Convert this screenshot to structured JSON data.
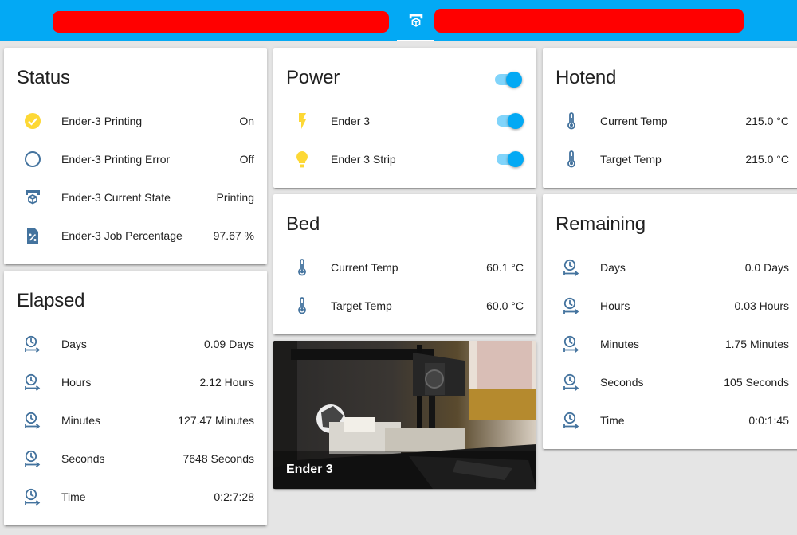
{
  "colors": {
    "primary": "#03a9f4",
    "icon_state_on": "#fdd835",
    "icon_default": "#44739e"
  },
  "status_card": {
    "title": "Status",
    "rows": [
      {
        "name": "Ender-3 Printing",
        "value": "On",
        "icon": "check-circle-icon"
      },
      {
        "name": "Ender-3 Printing Error",
        "value": "Off",
        "icon": "circle-outline-icon"
      },
      {
        "name": "Ender-3 Current State",
        "value": "Printing",
        "icon": "printer-3d-icon"
      },
      {
        "name": "Ender-3 Job Percentage",
        "value": "97.67 %",
        "icon": "file-percent-icon"
      }
    ]
  },
  "power_card": {
    "title": "Power",
    "master_toggle": true,
    "rows": [
      {
        "name": "Ender 3",
        "icon": "flash-icon",
        "toggle": true
      },
      {
        "name": "Ender 3 Strip",
        "icon": "lightbulb-icon",
        "toggle": true
      }
    ]
  },
  "hotend_card": {
    "title": "Hotend",
    "rows": [
      {
        "name": "Current Temp",
        "value": "215.0 °C",
        "icon": "thermometer-icon"
      },
      {
        "name": "Target Temp",
        "value": "215.0 °C",
        "icon": "thermometer-icon"
      }
    ]
  },
  "bed_card": {
    "title": "Bed",
    "rows": [
      {
        "name": "Current Temp",
        "value": "60.1 °C",
        "icon": "thermometer-icon"
      },
      {
        "name": "Target Temp",
        "value": "60.0 °C",
        "icon": "thermometer-icon"
      }
    ]
  },
  "remaining_card": {
    "title": "Remaining",
    "rows": [
      {
        "name": "Days",
        "value": "0.0 Days",
        "icon": "clock-end-icon"
      },
      {
        "name": "Hours",
        "value": "0.03 Hours",
        "icon": "clock-end-icon"
      },
      {
        "name": "Minutes",
        "value": "1.75 Minutes",
        "icon": "clock-end-icon"
      },
      {
        "name": "Seconds",
        "value": "105 Seconds",
        "icon": "clock-end-icon"
      },
      {
        "name": "Time",
        "value": "0:0:1:45",
        "icon": "clock-end-icon"
      }
    ]
  },
  "elapsed_card": {
    "title": "Elapsed",
    "rows": [
      {
        "name": "Days",
        "value": "0.09 Days",
        "icon": "clock-end-icon"
      },
      {
        "name": "Hours",
        "value": "2.12 Hours",
        "icon": "clock-end-icon"
      },
      {
        "name": "Minutes",
        "value": "127.47 Minutes",
        "icon": "clock-end-icon"
      },
      {
        "name": "Seconds",
        "value": "7648 Seconds",
        "icon": "clock-end-icon"
      },
      {
        "name": "Time",
        "value": "0:2:7:28",
        "icon": "clock-end-icon"
      }
    ]
  },
  "camera_card": {
    "caption": "Ender 3"
  }
}
